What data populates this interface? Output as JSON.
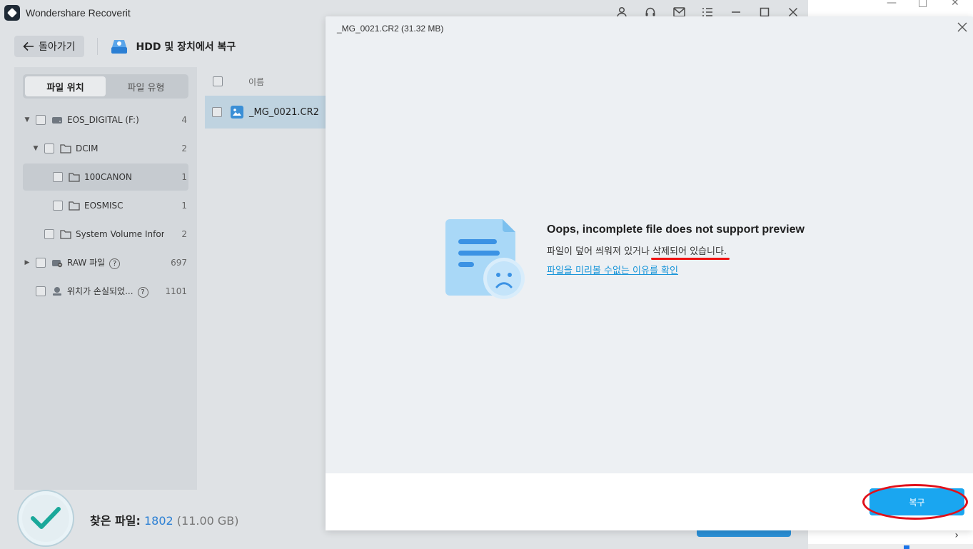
{
  "app": {
    "title": "Wondershare Recoverit"
  },
  "toolbar": {
    "back_label": "돌아가기",
    "crumb": "HDD 및 장치에서 복구"
  },
  "sidebar": {
    "tabs": [
      {
        "label": "파일 위치",
        "active": true
      },
      {
        "label": "파일 유형",
        "active": false
      }
    ],
    "tree": [
      {
        "label": "EOS_DIGITAL (F:)",
        "count": "4"
      },
      {
        "label": "DCIM",
        "count": "2"
      },
      {
        "label": "100CANON",
        "count": "1",
        "selected": true
      },
      {
        "label": "EOSMISC",
        "count": "1"
      },
      {
        "label": "System Volume Infor...",
        "count": "2"
      },
      {
        "label": "RAW 파일",
        "count": "697"
      },
      {
        "label": "위치가 손실되었...",
        "count": "1101"
      }
    ]
  },
  "list": {
    "header_name": "이름",
    "rows": [
      {
        "name": "_MG_0021.CR2"
      }
    ]
  },
  "footer": {
    "found_label": "찾은 파일:",
    "found_count": "1802",
    "found_size": "(11.00 GB)"
  },
  "modal": {
    "title": "_MG_0021.CR2 (31.32 MB)",
    "message_title": "Oops, incomplete file does not support preview",
    "message_sub_a": "파일이 덮어 씌워져 있거나 ",
    "message_sub_b": "삭제되어 있습니다.",
    "message_link": "파일을 미리볼 수없는 이유를 확인",
    "recover_label": "복구"
  },
  "colors": {
    "accent": "#1aa6f0",
    "annotation": "#e0101a",
    "link": "#1a96d9"
  }
}
